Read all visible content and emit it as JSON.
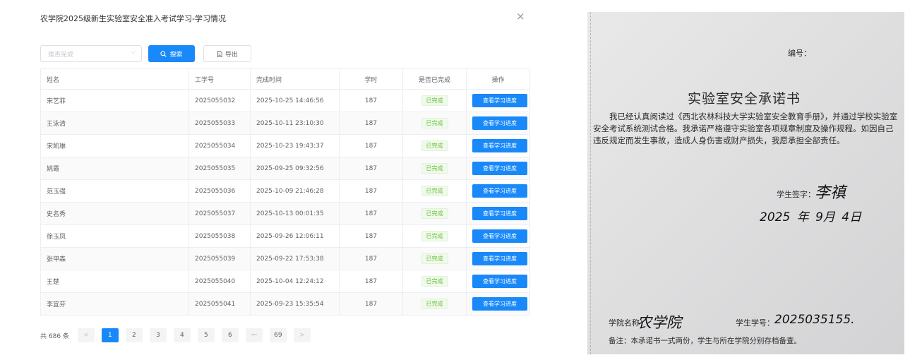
{
  "dialog": {
    "title": "农学院2025级新生实验室安全准入考试学习-学习情况",
    "close": "×"
  },
  "toolbar": {
    "status_placeholder": "是否完成",
    "search_label": "搜索",
    "export_label": "导出"
  },
  "table": {
    "headers": [
      "姓名",
      "工学号",
      "完成时间",
      "学时",
      "是否已完成",
      "操作"
    ],
    "rows": [
      {
        "name": "宋艺菲",
        "id": "2025055032",
        "time": "2025-10-25 14:46:56",
        "hours": "187",
        "status": "已完成",
        "action": "查看学习进度"
      },
      {
        "name": "王泳清",
        "id": "2025055033",
        "time": "2025-10-11 23:10:30",
        "hours": "187",
        "status": "已完成",
        "action": "查看学习进度"
      },
      {
        "name": "宋凯琳",
        "id": "2025055034",
        "time": "2025-10-23 19:43:37",
        "hours": "187",
        "status": "已完成",
        "action": "查看学习进度"
      },
      {
        "name": "姚霞",
        "id": "2025055035",
        "time": "2025-09-25 09:32:56",
        "hours": "187",
        "status": "已完成",
        "action": "查看学习进度"
      },
      {
        "name": "范玉强",
        "id": "2025055036",
        "time": "2025-10-09 21:46:28",
        "hours": "187",
        "status": "已完成",
        "action": "查看学习进度"
      },
      {
        "name": "史名秀",
        "id": "2025055037",
        "time": "2025-10-13 00:01:35",
        "hours": "187",
        "status": "已完成",
        "action": "查看学习进度"
      },
      {
        "name": "徐玉凤",
        "id": "2025055038",
        "time": "2025-09-26 12:06:11",
        "hours": "187",
        "status": "已完成",
        "action": "查看学习进度"
      },
      {
        "name": "张甲森",
        "id": "2025055039",
        "time": "2025-09-22 17:53:38",
        "hours": "187",
        "status": "已完成",
        "action": "查看学习进度"
      },
      {
        "name": "王楚",
        "id": "2025055040",
        "time": "2025-10-04 12:24:12",
        "hours": "187",
        "status": "已完成",
        "action": "查看学习进度"
      },
      {
        "name": "李宜芬",
        "id": "2025055041",
        "time": "2025-09-23 15:35:54",
        "hours": "187",
        "status": "已完成",
        "action": "查看学习进度"
      }
    ]
  },
  "pagination": {
    "total": "共 686 条",
    "prev": "<",
    "next": ">",
    "pages": [
      "1",
      "2",
      "3",
      "4",
      "5",
      "6",
      "···",
      "69"
    ],
    "current": "1"
  },
  "document": {
    "serial_label": "编号：",
    "title": "实验室安全承诺书",
    "body": "我已经认真阅读过《西北农林科技大学实验室安全教育手册》，并通过学校实验室安全考试系统测试合格。我承诺严格遵守实验室各项规章制度及操作规程。如因自己违反规定而发生事故，造成人身伤害或财产损失，我愿承担全部责任。",
    "signature_label": "学生签字：",
    "signature_name": "李禛",
    "date": "2025 年 9月 4日",
    "college_label": "学院名称：",
    "college_name": "农学院",
    "student_id_label": "学生学号：",
    "student_id": "2025035155.",
    "note": "备注：本承诺书一式两份，学生与所在学院分别存档备查。"
  },
  "colors": {
    "primary": "#1989fa",
    "success_text": "#67c23a",
    "success_bg": "#f0f9eb"
  }
}
